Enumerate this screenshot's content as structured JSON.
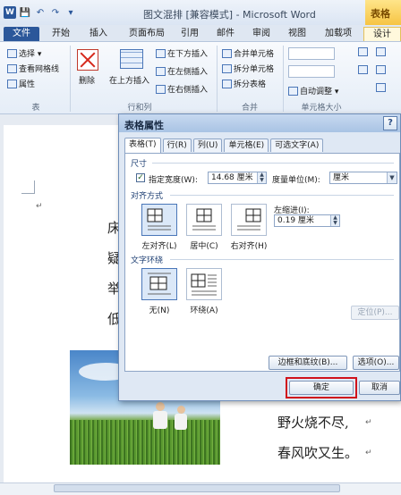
{
  "window": {
    "title": "图文混排 [兼容模式] - Microsoft Word",
    "context_tab_head": "表格"
  },
  "quick_access": [
    "W",
    "💾",
    "↶",
    "↷",
    "▾"
  ],
  "ribbon_tabs": [
    "文件",
    "开始",
    "插入",
    "页面布局",
    "引用",
    "邮件",
    "审阅",
    "视图",
    "加载项",
    "设计"
  ],
  "ribbon": {
    "table_group": {
      "select": "选择 ▾",
      "gridlines": "查看网格线",
      "properties": "属性",
      "label": "表"
    },
    "rows_cols_group": {
      "delete": "删除",
      "insert_above": "在上方插入",
      "insert_below": "在下方插入",
      "insert_left": "在左侧插入",
      "insert_right": "在右侧插入",
      "label": "行和列"
    },
    "merge_group": {
      "merge_cells": "合并单元格",
      "split_cells": "拆分单元格",
      "split_table": "拆分表格",
      "label": "合并"
    },
    "cell_size_group": {
      "autofit": "自动调整 ▾",
      "label": "单元格大小"
    }
  },
  "document": {
    "left_chars": [
      "床",
      "疑",
      "举",
      "低"
    ],
    "poem_line_1": "野火烧不尽,",
    "poem_line_2": "春风吹又生。",
    "para_mark": "↵"
  },
  "dialog": {
    "title": "表格属性",
    "help": "?",
    "tabs": [
      "表格(T)",
      "行(R)",
      "列(U)",
      "单元格(E)",
      "可选文字(A)"
    ],
    "size_section": "尺寸",
    "preferred_width_label": "指定宽度(W):",
    "preferred_width_checked": true,
    "preferred_width_value": "14.68 厘米",
    "measure_label": "度量单位(M):",
    "measure_value": "厘米",
    "alignment_section": "对齐方式",
    "alignment_options": [
      "左对齐(L)",
      "居中(C)",
      "右对齐(H)"
    ],
    "alignment_selected": "左对齐(L)",
    "indent_label": "左缩进(I):",
    "indent_value": "0.19 厘米",
    "wrap_section": "文字环绕",
    "wrap_options": [
      "无(N)",
      "环绕(A)"
    ],
    "wrap_selected": "无(N)",
    "positioning_button": "定位(P)...",
    "borders_button": "边框和底纹(B)...",
    "options_button": "选项(O)...",
    "ok_button": "确定",
    "cancel_button": "取消"
  }
}
